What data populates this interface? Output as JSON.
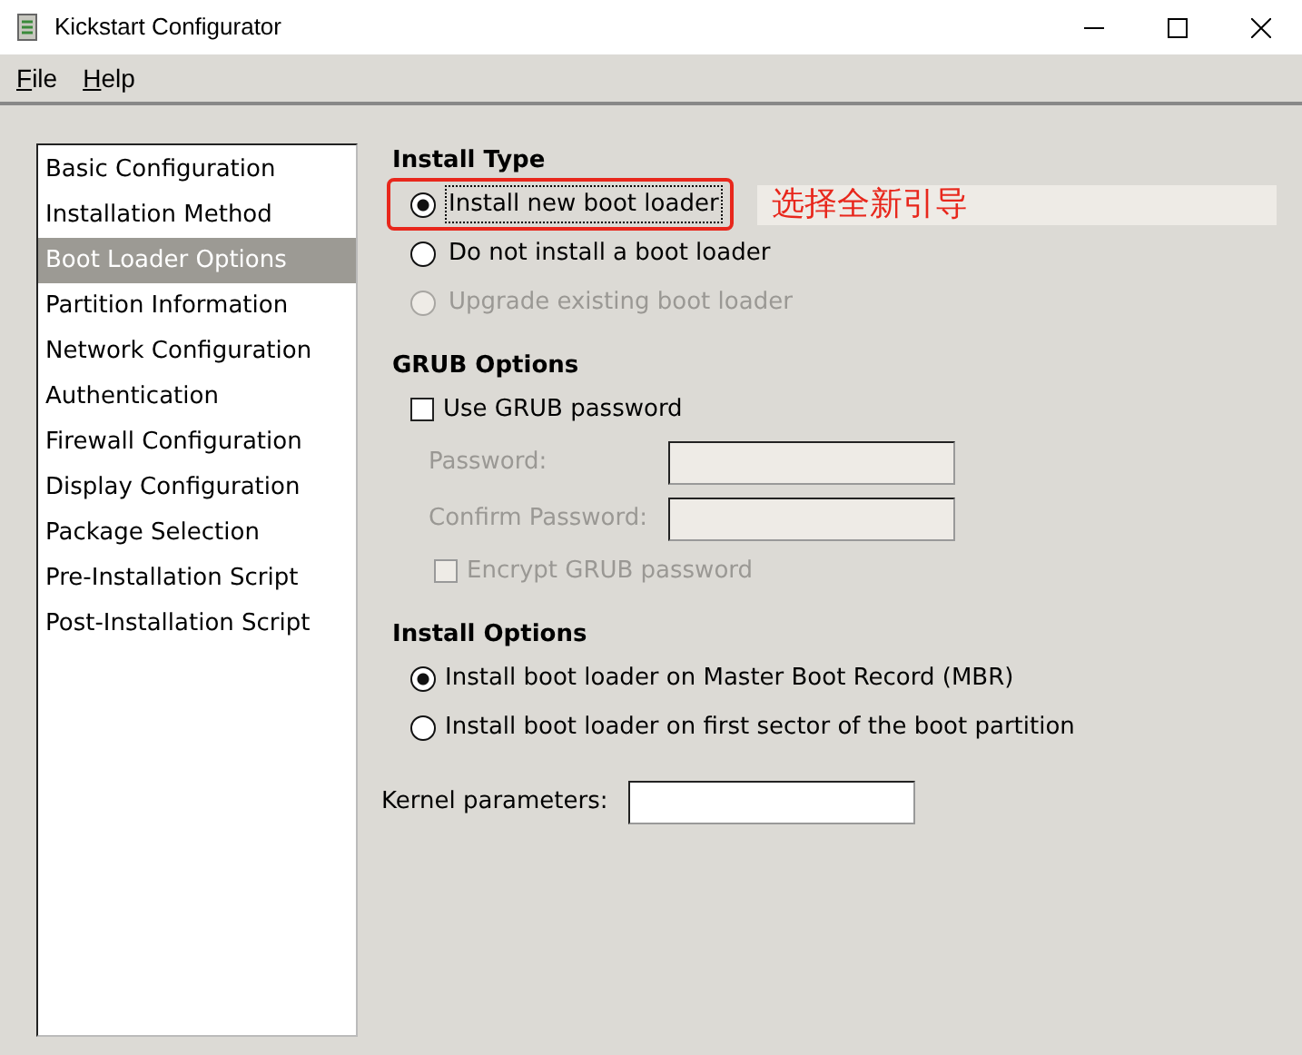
{
  "window": {
    "title": "Kickstart Configurator"
  },
  "menu": [
    {
      "label": "File"
    },
    {
      "label": "Help"
    }
  ],
  "sidebar": {
    "items": [
      {
        "label": "Basic Configuration",
        "selected": false
      },
      {
        "label": "Installation Method",
        "selected": false
      },
      {
        "label": "Boot Loader Options",
        "selected": true
      },
      {
        "label": "Partition Information",
        "selected": false
      },
      {
        "label": "Network Configuration",
        "selected": false
      },
      {
        "label": "Authentication",
        "selected": false
      },
      {
        "label": "Firewall Configuration",
        "selected": false
      },
      {
        "label": "Display Configuration",
        "selected": false
      },
      {
        "label": "Package Selection",
        "selected": false
      },
      {
        "label": "Pre-Installation Script",
        "selected": false
      },
      {
        "label": "Post-Installation Script",
        "selected": false
      }
    ]
  },
  "install_type": {
    "title": "Install Type",
    "options": [
      {
        "label": "Install new boot loader",
        "selected": true,
        "disabled": false,
        "focused": true,
        "highlighted": true
      },
      {
        "label": "Do not install a boot loader",
        "selected": false,
        "disabled": false,
        "focused": false,
        "highlighted": false
      },
      {
        "label": "Upgrade existing boot loader",
        "selected": false,
        "disabled": true,
        "focused": false,
        "highlighted": false
      }
    ],
    "annotation": {
      "text": "选择全新引导"
    }
  },
  "grub_options": {
    "title": "GRUB Options",
    "use_password": {
      "label": "Use GRUB password",
      "checked": false,
      "disabled": false
    },
    "fields": [
      {
        "label": "Password:",
        "disabled": true
      },
      {
        "label": "Confirm Password:",
        "disabled": true
      }
    ],
    "encrypt": {
      "label": "Encrypt GRUB password",
      "checked": false,
      "disabled": true
    }
  },
  "install_options": {
    "title": "Install Options",
    "options": [
      {
        "label": "Install boot loader on Master Boot Record (MBR)",
        "selected": true
      },
      {
        "label": "Install boot loader on first sector of the boot partition",
        "selected": false
      }
    ]
  },
  "kernel_parameters": {
    "label": "Kernel parameters:"
  }
}
